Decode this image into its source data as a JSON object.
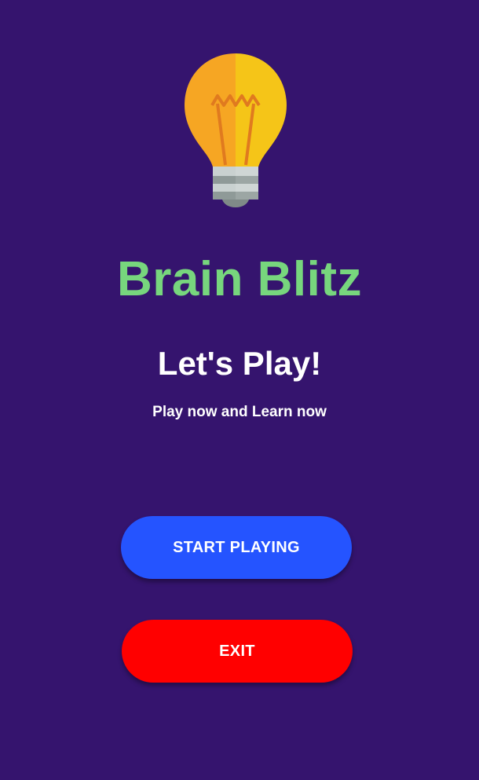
{
  "app": {
    "title": "Brain Blitz",
    "headline": "Let's Play!",
    "subtitle": "Play now and Learn now"
  },
  "buttons": {
    "start_label": "START PLAYING",
    "exit_label": "EXIT"
  },
  "icons": {
    "logo": "lightbulb-icon"
  },
  "colors": {
    "background": "#35146e",
    "title": "#77d67d",
    "start_button": "#2554ff",
    "exit_button": "#ff0000"
  }
}
